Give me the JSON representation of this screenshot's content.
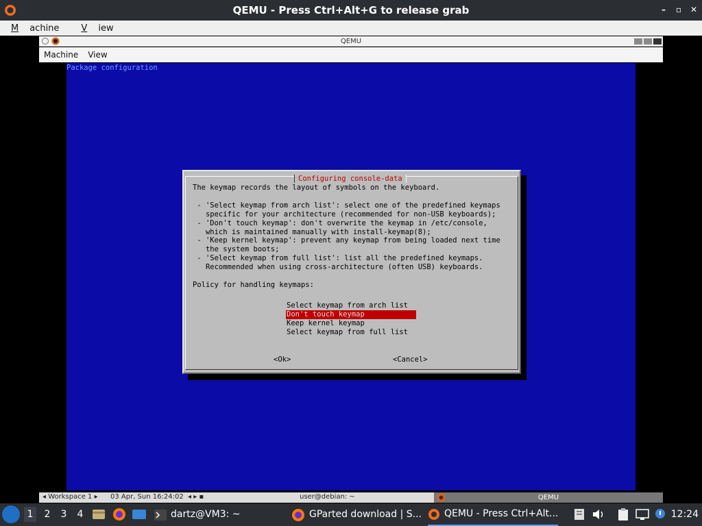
{
  "outer_window": {
    "title": "QEMU - Press Ctrl+Alt+G to release grab",
    "menu": [
      {
        "label": "Machine",
        "accel": "M",
        "rest": "achine"
      },
      {
        "label": "View",
        "accel": "V",
        "rest": "iew"
      }
    ],
    "controls": [
      "–",
      "▫",
      "✕"
    ]
  },
  "inner_window": {
    "title": "QEMU",
    "menu": [
      "Machine",
      "View"
    ],
    "status": {
      "workspace": "◂ Workspace 1 ▸",
      "datetime": "03 Apr, Sun 16:24:02",
      "nav": "◂ ▸ ▪",
      "user": "user@debian: ~",
      "qemu": "QEMU"
    }
  },
  "vm": {
    "header": "Package configuration",
    "dialog": {
      "title": "Configuring console-data",
      "body": "The keymap records the layout of symbols on the keyboard.\n\n - 'Select keymap from arch list': select one of the predefined keymaps\n   specific for your architecture (recommended for non-USB keyboards);\n - 'Don't touch keymap': don't overwrite the keymap in /etc/console,\n   which is maintained manually with install-keymap(8);\n - 'Keep kernel keymap': prevent any keymap from being loaded next time\n   the system boots;\n - 'Select keymap from full list': list all the predefined keymaps.\n   Recommended when using cross-architecture (often USB) keyboards.\n\nPolicy for handling keymaps:",
      "options": [
        "Select keymap from arch list",
        "Don't touch keymap",
        "Keep kernel keymap",
        "Select keymap from full list"
      ],
      "selected_index": 1,
      "ok": "<Ok>",
      "cancel": "<Cancel>"
    }
  },
  "taskbar": {
    "workspaces": [
      "1",
      "2",
      "3",
      "4"
    ],
    "active_workspace": "1",
    "launchers": [
      "file-manager-icon",
      "firefox-icon",
      "desktop-icon"
    ],
    "tasks": [
      {
        "label": "dartz@VM3: ~",
        "icon": "terminal-icon"
      },
      {
        "label": "GParted download | S...",
        "icon": "firefox-icon"
      },
      {
        "label": "QEMU - Press Ctrl+Alt...",
        "icon": "qemu-icon"
      }
    ],
    "tray": [
      "notes-icon",
      "volume-icon",
      "clipboard-icon",
      "network-icon",
      "update-icon"
    ],
    "clock": "12:24"
  },
  "colors": {
    "vm_background": "#0b0ba7",
    "dialog": "#bdbdbd",
    "highlight": "#c00000",
    "taskbar": "#2b2e33"
  }
}
